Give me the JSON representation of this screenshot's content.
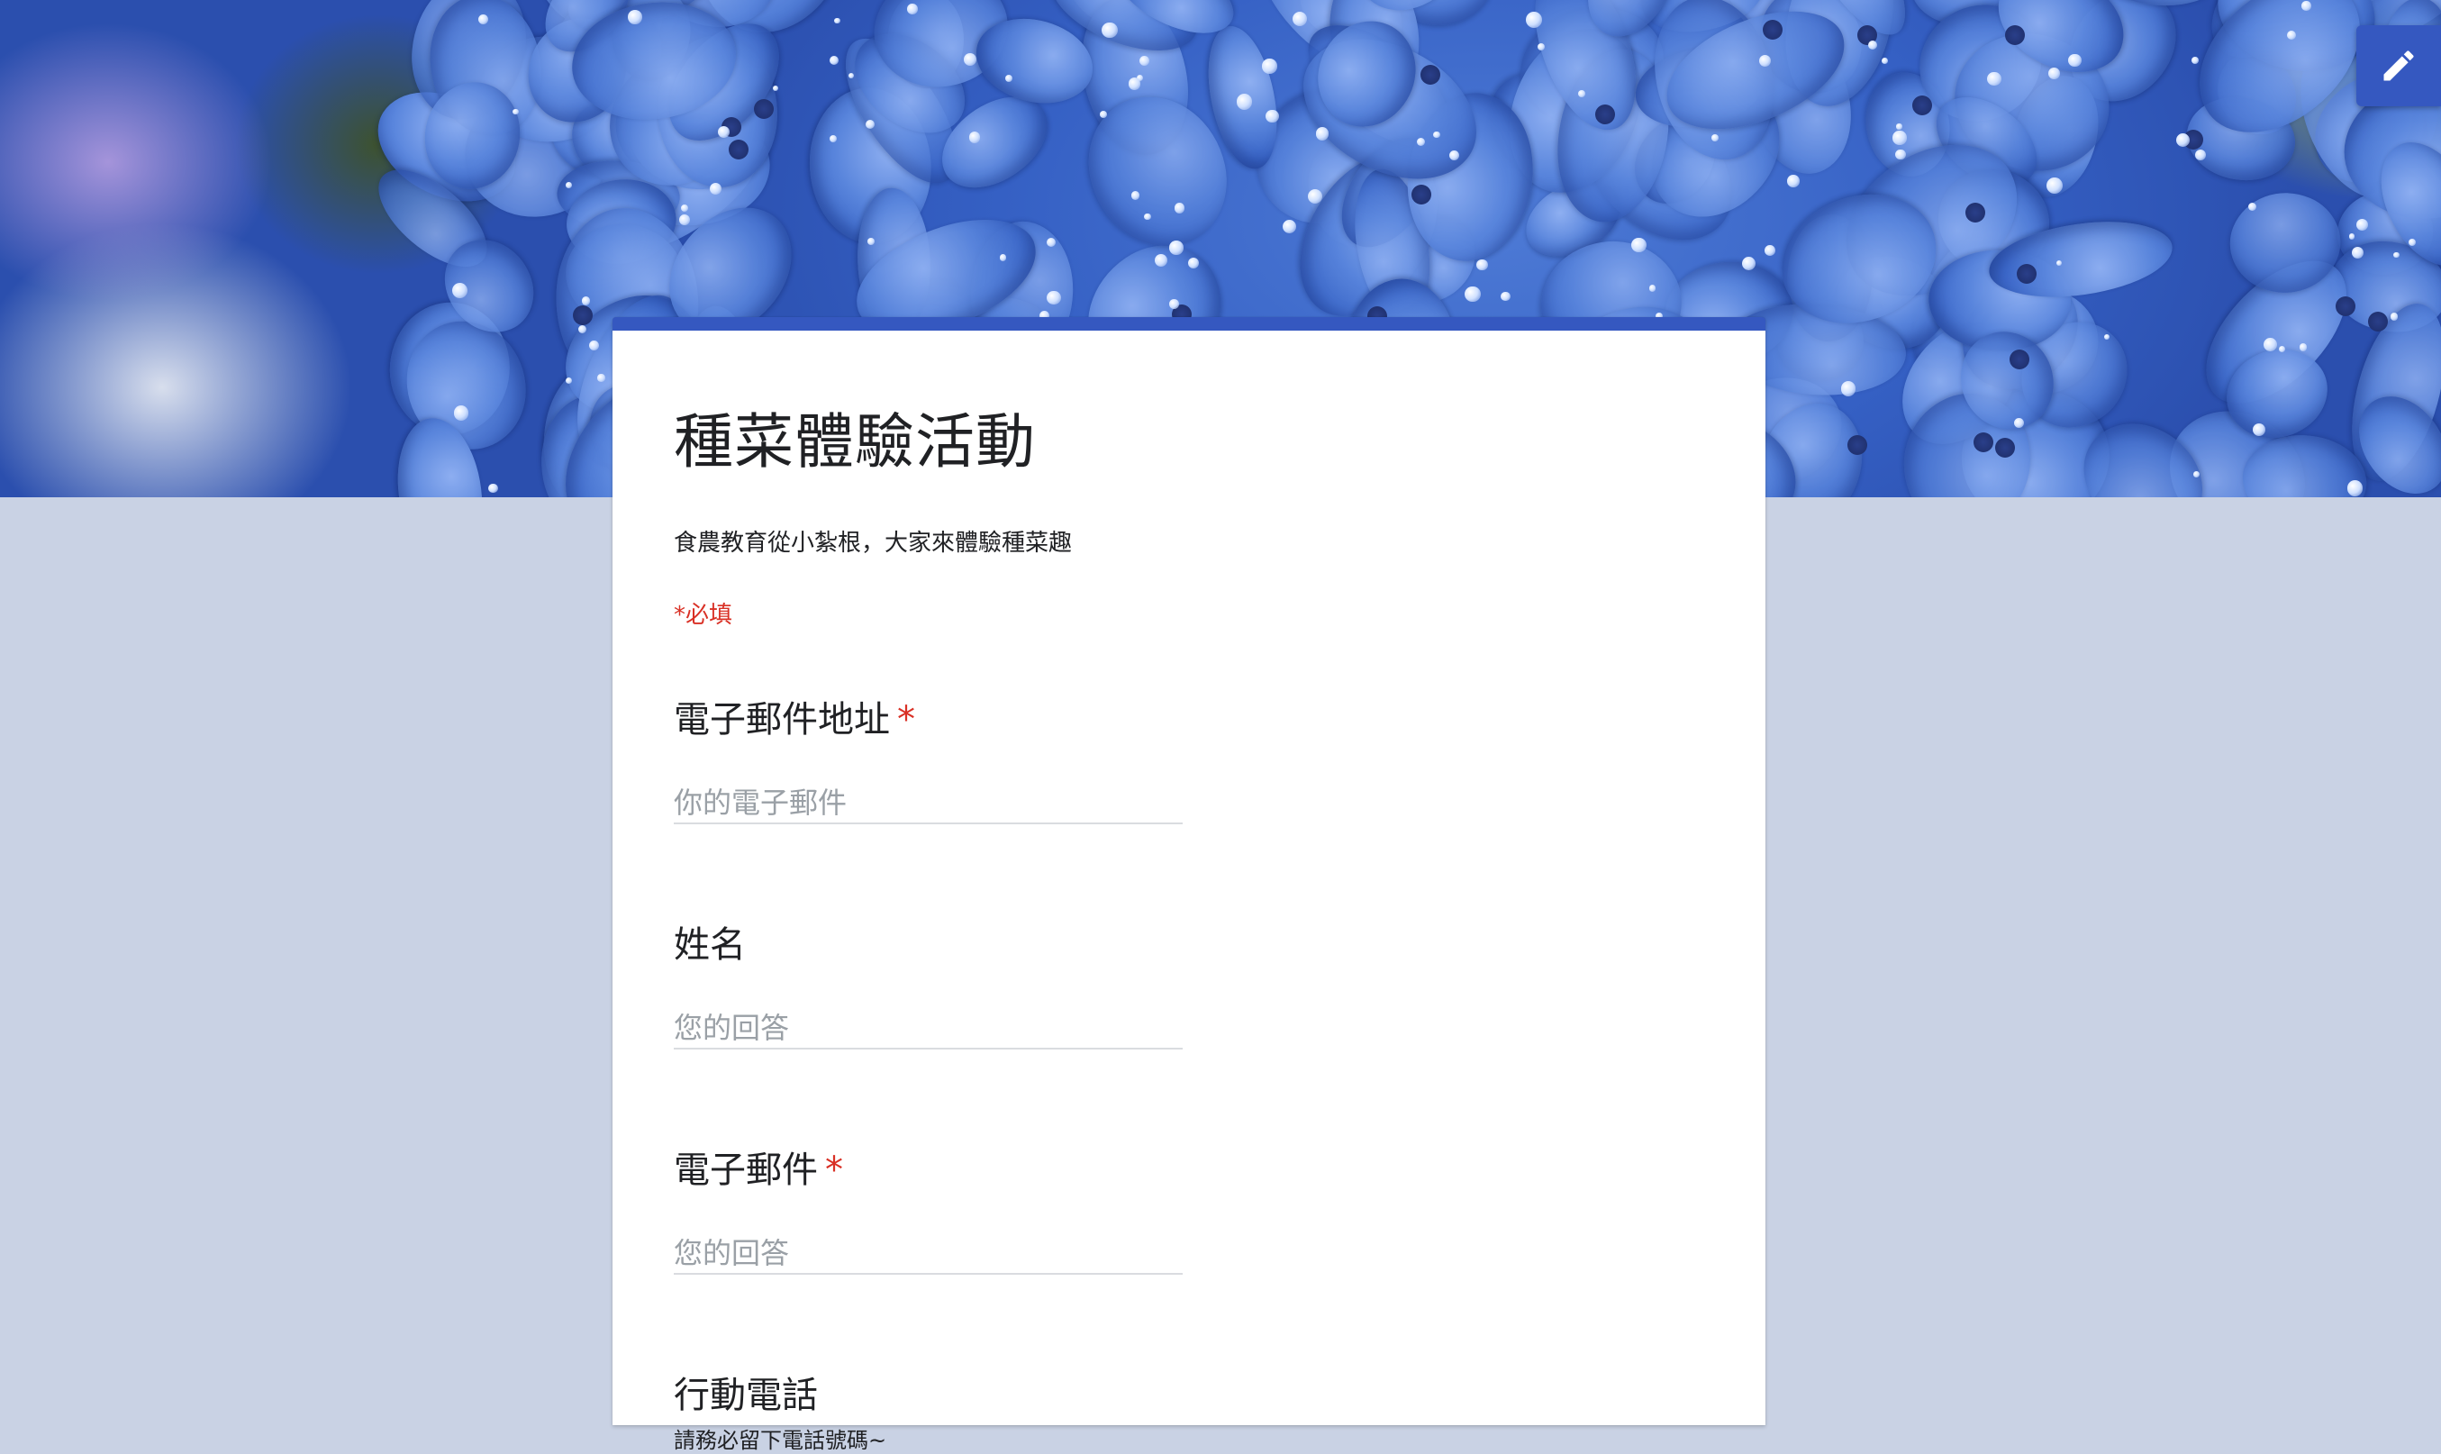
{
  "form": {
    "title": "種菜體驗活動",
    "description": "食農教育從小紮根，大家來體驗種菜趣",
    "required_note": "*必填",
    "accent_color": "#3558c0",
    "background_color": "#c9d2e4",
    "required_color": "#d93025"
  },
  "questions": [
    {
      "title": "電子郵件地址",
      "required": true,
      "star": "*",
      "placeholder": "你的電子郵件"
    },
    {
      "title": "姓名",
      "required": false,
      "star": "",
      "placeholder": "您的回答"
    },
    {
      "title": "電子郵件",
      "required": true,
      "star": "*",
      "placeholder": "您的回答"
    },
    {
      "title": "行動電話",
      "required": false,
      "star": "",
      "helper": "請務必留下電話號碼~"
    }
  ],
  "edit_button": {
    "icon": "pencil-icon"
  }
}
